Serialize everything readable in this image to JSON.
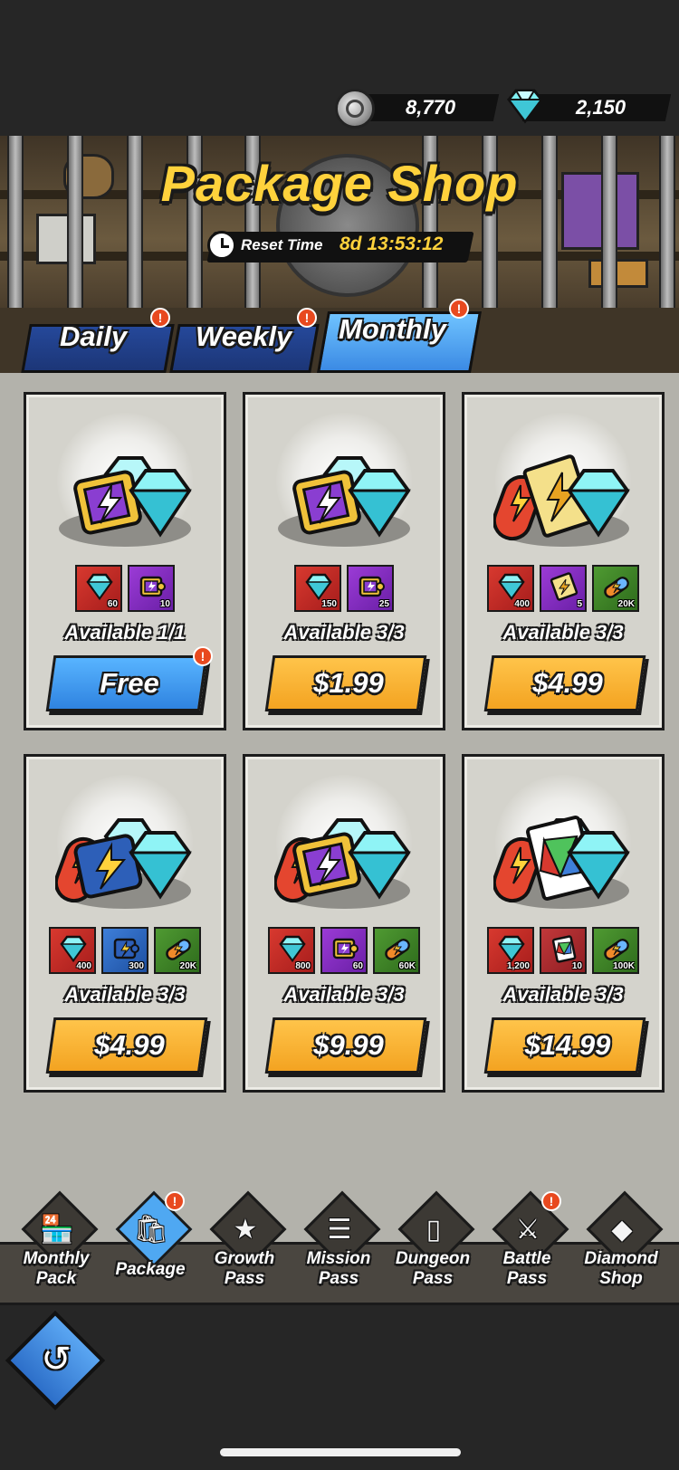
{
  "currency": {
    "coins": "8,770",
    "gems": "2,150"
  },
  "header": {
    "title": "Package Shop",
    "reset_label": "Reset Time",
    "reset_time": "8d 13:53:12"
  },
  "tabs": [
    {
      "label": "Daily",
      "badge": "!"
    },
    {
      "label": "Weekly",
      "badge": "!"
    },
    {
      "label": "Monthly",
      "badge": "!",
      "active": true
    }
  ],
  "packages": [
    {
      "items": [
        {
          "icon": "gem",
          "qty": "60"
        },
        {
          "icon": "puzzle-purple",
          "qty": "10"
        }
      ],
      "available": "Available 1/1",
      "price": "Free",
      "badge": "!"
    },
    {
      "items": [
        {
          "icon": "gem",
          "qty": "150"
        },
        {
          "icon": "puzzle-purple",
          "qty": "25"
        }
      ],
      "available": "Available 3/3",
      "price": "$1.99"
    },
    {
      "items": [
        {
          "icon": "gem",
          "qty": "400"
        },
        {
          "icon": "ticket",
          "qty": "5"
        },
        {
          "icon": "capsule",
          "qty": "20K"
        }
      ],
      "available": "Available 3/3",
      "price": "$4.99"
    },
    {
      "items": [
        {
          "icon": "gem",
          "qty": "400"
        },
        {
          "icon": "puzzle-blue",
          "qty": "300"
        },
        {
          "icon": "capsule",
          "qty": "20K"
        }
      ],
      "available": "Available 3/3",
      "price": "$4.99"
    },
    {
      "items": [
        {
          "icon": "gem",
          "qty": "800"
        },
        {
          "icon": "puzzle-purple",
          "qty": "60"
        },
        {
          "icon": "capsule",
          "qty": "60K"
        }
      ],
      "available": "Available 3/3",
      "price": "$9.99"
    },
    {
      "items": [
        {
          "icon": "gem",
          "qty": "1,200"
        },
        {
          "icon": "card",
          "qty": "10"
        },
        {
          "icon": "capsule",
          "qty": "100K"
        }
      ],
      "available": "Available 3/3",
      "price": "$14.99"
    }
  ],
  "nav": [
    {
      "line1": "Monthly",
      "line2": "Pack",
      "icon": "shop-icon"
    },
    {
      "line1": "Package",
      "line2": "",
      "icon": "package-icon",
      "active": true,
      "badge": "!"
    },
    {
      "line1": "Growth",
      "line2": "Pass",
      "icon": "growth-pass-icon"
    },
    {
      "line1": "Mission",
      "line2": "Pass",
      "icon": "mission-pass-icon"
    },
    {
      "line1": "Dungeon",
      "line2": "Pass",
      "icon": "dungeon-pass-icon"
    },
    {
      "line1": "Battle",
      "line2": "Pass",
      "icon": "battle-pass-icon",
      "badge": "!"
    },
    {
      "line1": "Diamond",
      "line2": "Shop",
      "icon": "diamond-shop-icon"
    }
  ],
  "colors": {
    "accent_gold": "#ffd23c",
    "price_orange": "#f3a321",
    "free_blue": "#2f83e0",
    "badge_red": "#e8491f"
  }
}
